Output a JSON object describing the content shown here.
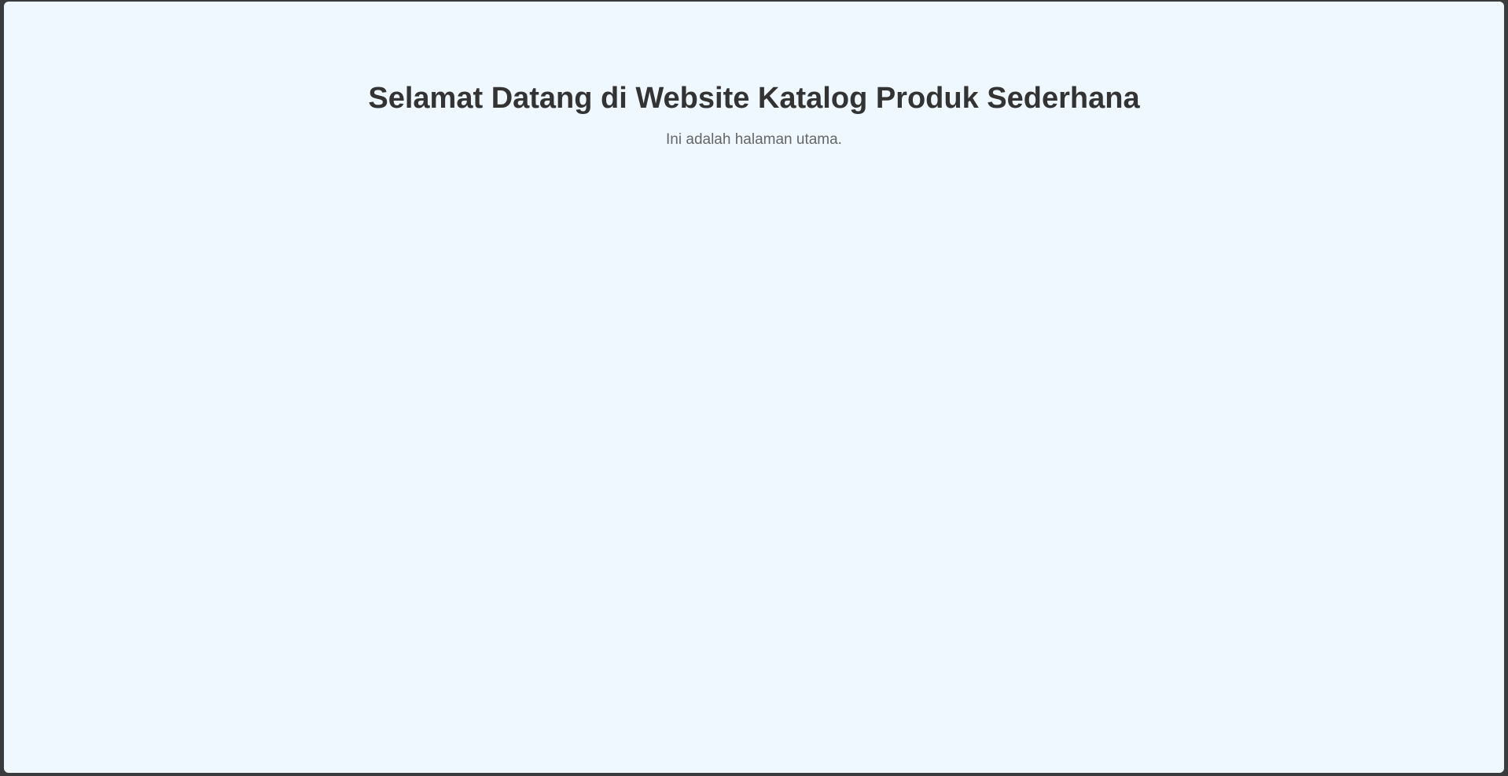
{
  "main": {
    "title": "Selamat Datang di Website Katalog Produk Sederhana",
    "subtitle": "Ini adalah halaman utama."
  },
  "colors": {
    "window_frame": "#3a3b3c",
    "page_background": "#eff8ff",
    "title_text": "#333333",
    "subtitle_text": "#666666"
  }
}
